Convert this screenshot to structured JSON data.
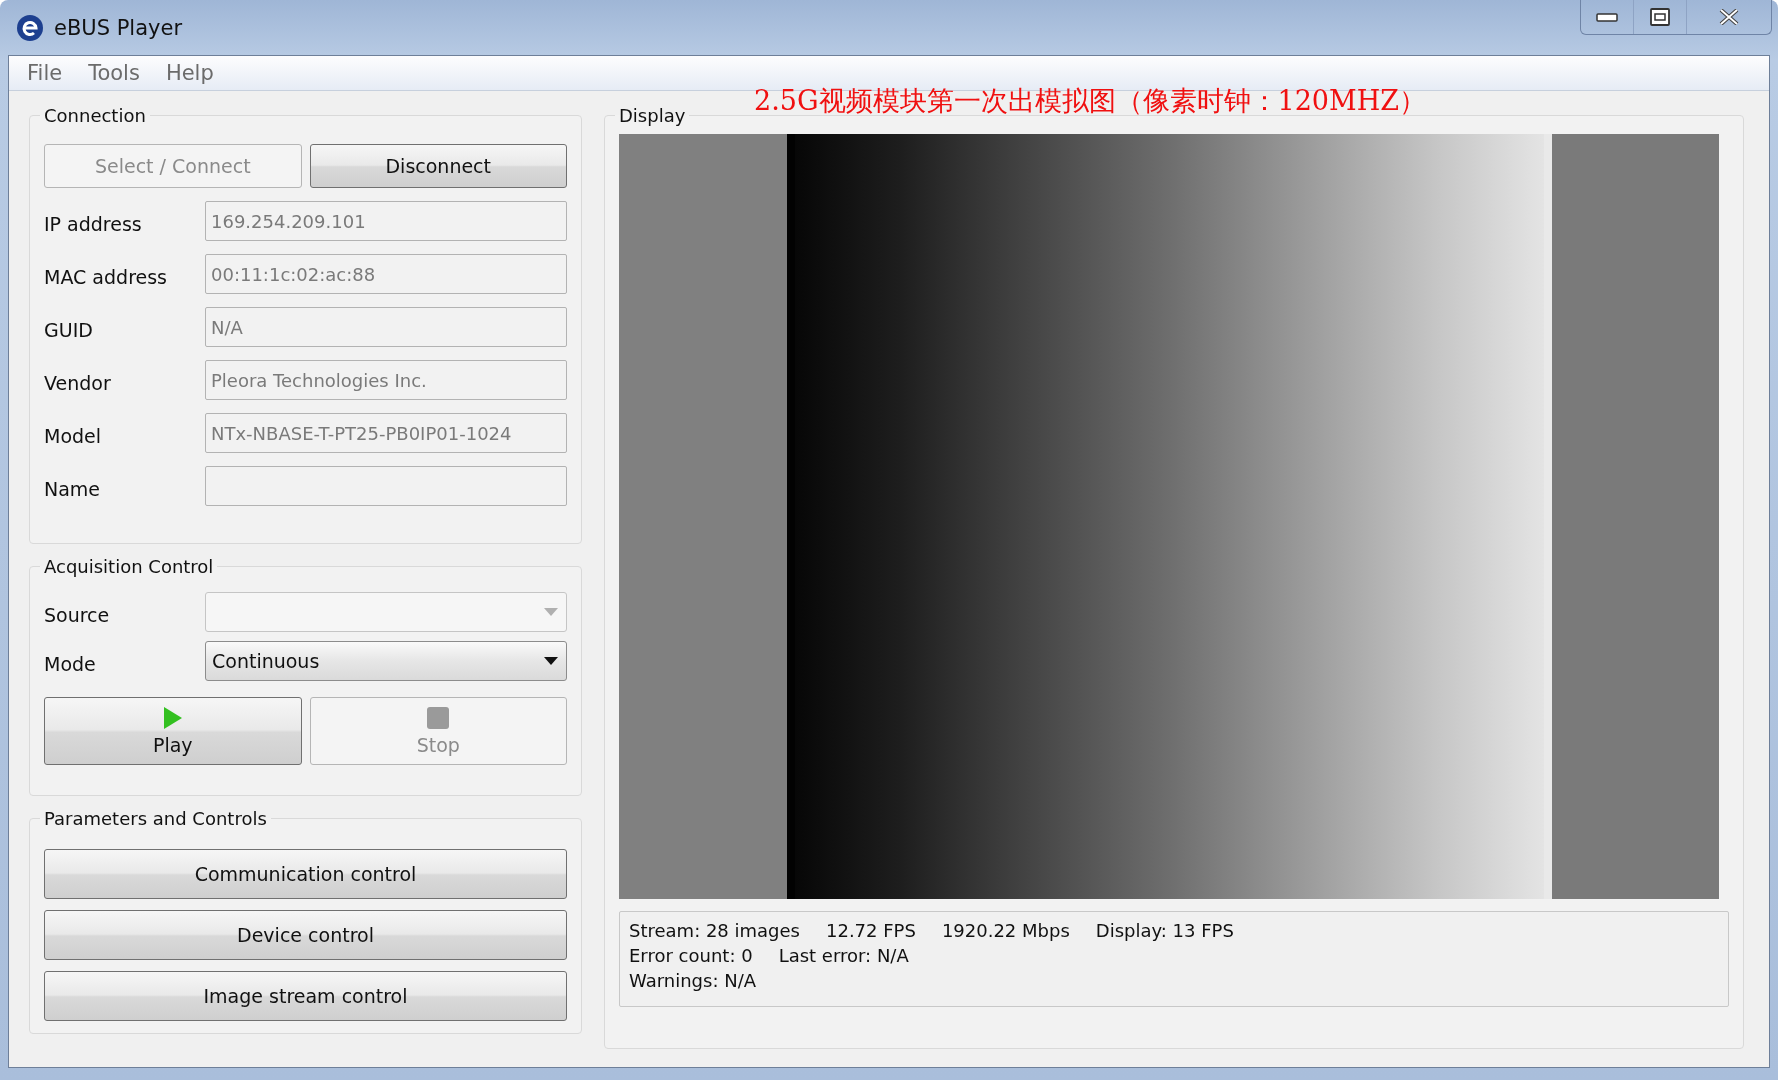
{
  "window": {
    "title": "eBUS Player"
  },
  "menu": [
    "File",
    "Tools",
    "Help"
  ],
  "connection": {
    "title": "Connection",
    "buttons": [
      {
        "label": "Select / Connect",
        "disabled": true
      },
      {
        "label": "Disconnect",
        "disabled": false
      }
    ],
    "fields": [
      {
        "label": "IP address",
        "value": "169.254.209.101"
      },
      {
        "label": "MAC address",
        "value": "00:11:1c:02:ac:88"
      },
      {
        "label": "GUID",
        "value": "N/A"
      },
      {
        "label": "Vendor",
        "value": "Pleora Technologies Inc."
      },
      {
        "label": "Model",
        "value": "NTx-NBASE-T-PT25-PB0IP01-1024"
      },
      {
        "label": "Name"
      }
    ]
  },
  "acquisition": {
    "title": "Acquisition Control",
    "source": {
      "label": "Source",
      "disabled": true
    },
    "mode": {
      "label": "Mode",
      "value": "Continuous",
      "disabled": false
    },
    "buttons": [
      {
        "kind": "play",
        "label": "Play",
        "disabled": false
      },
      {
        "kind": "stop",
        "label": "Stop",
        "disabled": true
      }
    ]
  },
  "parameters": {
    "title": "Parameters and Controls",
    "buttons": [
      "Communication control",
      "Device control",
      "Image stream control"
    ]
  },
  "display": {
    "title": "Display",
    "annotation": "2.5G视频模块第一次出模拟图（像素时钟：120MHZ）",
    "status_lines": [
      [
        "Stream: 28 images",
        "12.72 FPS",
        "1920.22 Mbps",
        "Display: 13 FPS"
      ],
      [
        "Error count: 0",
        "Last error: N/A"
      ],
      [
        "Warnings: N/A"
      ]
    ]
  }
}
